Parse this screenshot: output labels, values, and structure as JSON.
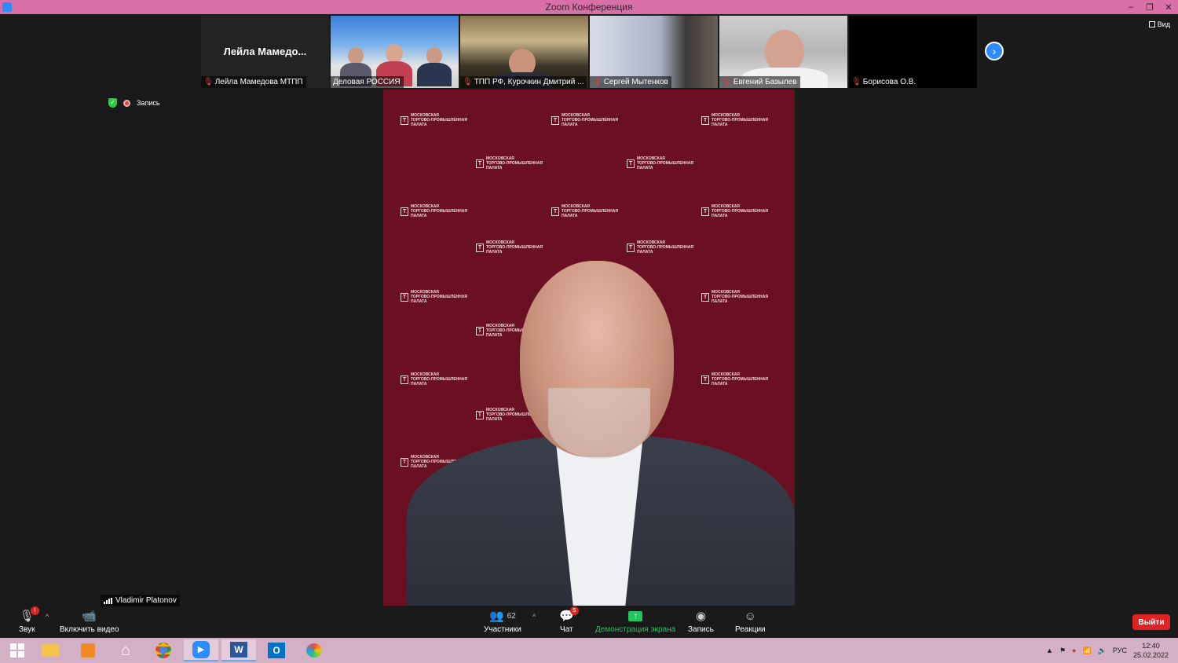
{
  "window": {
    "title": "Zoom Конференция",
    "minimize": "–",
    "restore": "❐",
    "close": "✕"
  },
  "gallery": {
    "tiles": [
      {
        "name": "Лейла Мамедова МТПП",
        "center_name": "Лейла  Мамедо...",
        "muted": true
      },
      {
        "name": "Деловая РОССИЯ",
        "muted": false
      },
      {
        "name": "ТПП РФ, Курочкин Дмитрий ...",
        "muted": true
      },
      {
        "name": "Сергей Мытенков",
        "muted": true
      },
      {
        "name": "Евгений Базылев",
        "muted": true
      },
      {
        "name": "Борисова О.В.",
        "muted": true
      }
    ],
    "view_label": "Вид"
  },
  "status": {
    "recording_label": "Запись"
  },
  "main_video": {
    "speaker_name": "Vladimir Platonov",
    "backdrop_logo": [
      "МОСКОВСКАЯ",
      "ТОРГОВО-ПРОМЫШЛЕННАЯ",
      "ПАЛАТА"
    ]
  },
  "toolbar": {
    "audio_label": "Звук",
    "audio_badge": "!",
    "video_label": "Включить видео",
    "participants_label": "Участники",
    "participants_count": "62",
    "chat_label": "Чат",
    "chat_badge": "5",
    "share_label": "Демонстрация экрана",
    "record_label": "Запись",
    "reactions_label": "Реакции",
    "leave_label": "Выйти"
  },
  "taskbar": {
    "language": "РУС",
    "time": "12:40",
    "date": "25.02.2022"
  },
  "colors": {
    "title_bar": "#d86fa6",
    "accent": "#2d8cff",
    "share_green": "#22c55e",
    "leave_red": "#e02424",
    "backdrop": "#6b0f22"
  }
}
